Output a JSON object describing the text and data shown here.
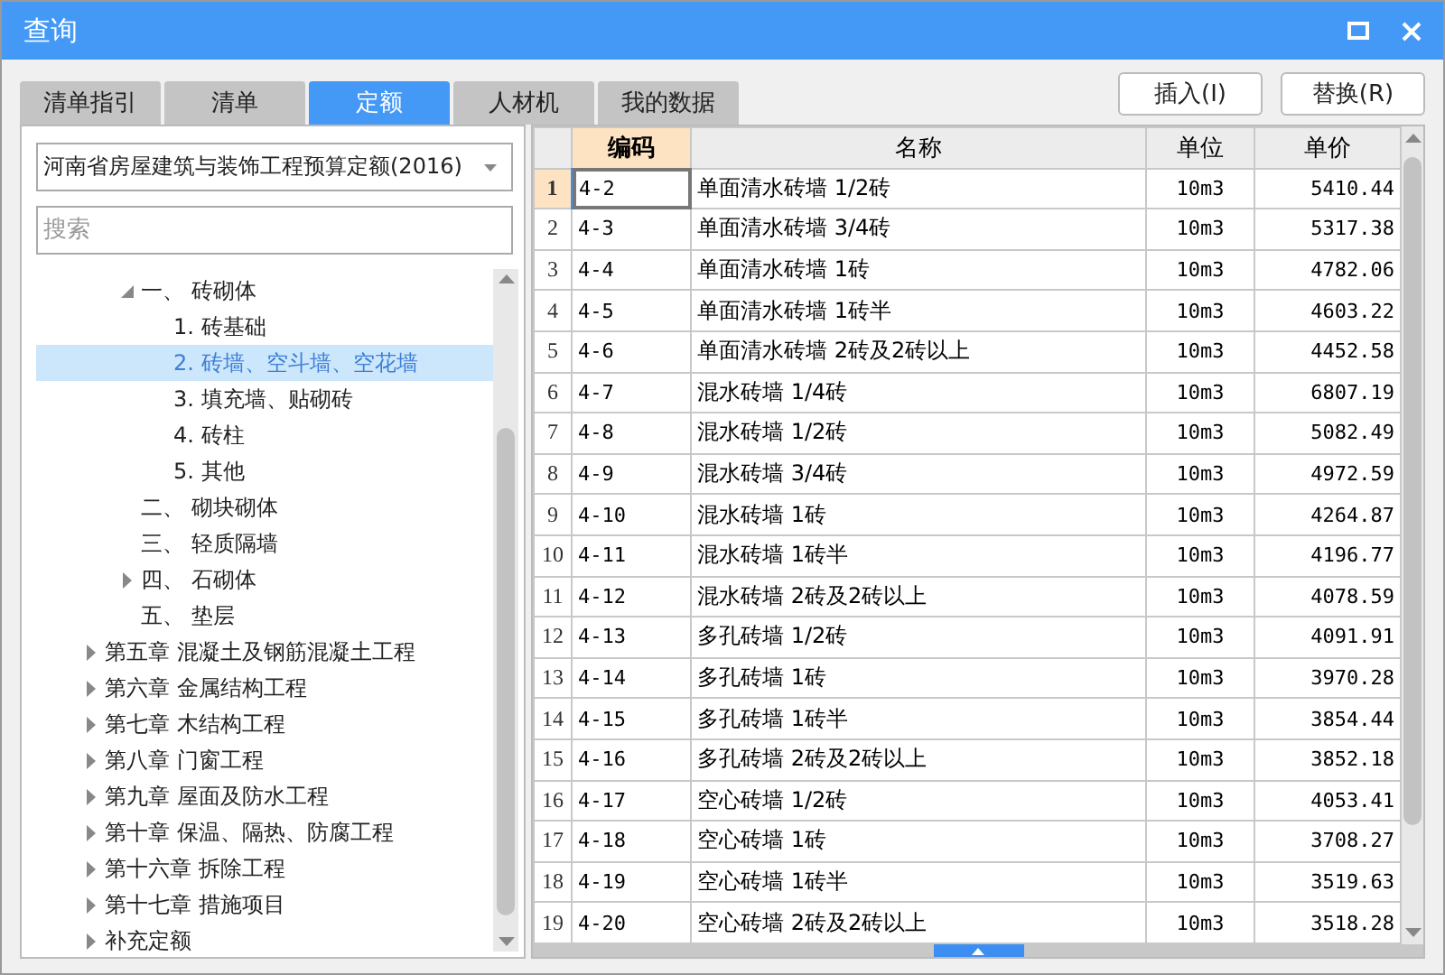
{
  "window": {
    "title": "查询"
  },
  "tabs": [
    {
      "label": "清单指引",
      "selected": false
    },
    {
      "label": "清单",
      "selected": false
    },
    {
      "label": "定额",
      "selected": true
    },
    {
      "label": "人材机",
      "selected": false
    },
    {
      "label": "我的数据",
      "selected": false
    }
  ],
  "buttons": [
    {
      "label": "插入(I)"
    },
    {
      "label": "替换(R)"
    }
  ],
  "library_select": {
    "value": "河南省房屋建筑与装饰工程预算定额(2016)"
  },
  "search": {
    "placeholder": "搜索"
  },
  "tree": {
    "sections": [
      {
        "label": "一、 砖砌体",
        "expanded": true,
        "selected": false,
        "children": [
          {
            "label": "1. 砖基础",
            "selected": false
          },
          {
            "label": "2. 砖墙、空斗墙、空花墙",
            "selected": true
          },
          {
            "label": "3. 填充墙、贴砌砖",
            "selected": false
          },
          {
            "label": "4. 砖柱",
            "selected": false
          },
          {
            "label": "5. 其他",
            "selected": false
          }
        ]
      },
      {
        "label": "二、 砌块砌体",
        "selected": false
      },
      {
        "label": "三、 轻质隔墙",
        "selected": false
      },
      {
        "label": "四、 石砌体",
        "expanded": false,
        "selected": false
      },
      {
        "label": "五、 垫层",
        "selected": false
      }
    ],
    "chapters": [
      {
        "label": "第五章 混凝土及钢筋混凝土工程",
        "expanded": false,
        "selected": false
      },
      {
        "label": "第六章 金属结构工程",
        "expanded": false,
        "selected": false
      },
      {
        "label": "第七章 木结构工程",
        "expanded": false,
        "selected": false
      },
      {
        "label": "第八章 门窗工程",
        "expanded": false,
        "selected": false
      },
      {
        "label": "第九章 屋面及防水工程",
        "expanded": false,
        "selected": false
      },
      {
        "label": "第十章 保温、隔热、防腐工程",
        "expanded": false,
        "selected": false
      },
      {
        "label": "第十六章 拆除工程",
        "expanded": false,
        "selected": false
      },
      {
        "label": "第十七章 措施项目",
        "expanded": false,
        "selected": false
      },
      {
        "label": "补充定额",
        "expanded": false,
        "selected": false
      }
    ]
  },
  "table": {
    "columns": [
      {
        "label": "编码",
        "selected": true
      },
      {
        "label": "名称",
        "selected": false
      },
      {
        "label": "单位",
        "selected": false
      },
      {
        "label": "单价",
        "selected": false
      }
    ],
    "rows": [
      {
        "num": "1",
        "code": "4-2",
        "name": "单面清水砖墙 1/2砖",
        "unit": "10m3",
        "price": "5410.44",
        "selected": true
      },
      {
        "num": "2",
        "code": "4-3",
        "name": "单面清水砖墙 3/4砖",
        "unit": "10m3",
        "price": "5317.38",
        "selected": false
      },
      {
        "num": "3",
        "code": "4-4",
        "name": "单面清水砖墙 1砖",
        "unit": "10m3",
        "price": "4782.06",
        "selected": false
      },
      {
        "num": "4",
        "code": "4-5",
        "name": "单面清水砖墙 1砖半",
        "unit": "10m3",
        "price": "4603.22",
        "selected": false
      },
      {
        "num": "5",
        "code": "4-6",
        "name": "单面清水砖墙 2砖及2砖以上",
        "unit": "10m3",
        "price": "4452.58",
        "selected": false
      },
      {
        "num": "6",
        "code": "4-7",
        "name": "混水砖墙 1/4砖",
        "unit": "10m3",
        "price": "6807.19",
        "selected": false
      },
      {
        "num": "7",
        "code": "4-8",
        "name": "混水砖墙 1/2砖",
        "unit": "10m3",
        "price": "5082.49",
        "selected": false
      },
      {
        "num": "8",
        "code": "4-9",
        "name": "混水砖墙 3/4砖",
        "unit": "10m3",
        "price": "4972.59",
        "selected": false
      },
      {
        "num": "9",
        "code": "4-10",
        "name": "混水砖墙 1砖",
        "unit": "10m3",
        "price": "4264.87",
        "selected": false
      },
      {
        "num": "10",
        "code": "4-11",
        "name": "混水砖墙 1砖半",
        "unit": "10m3",
        "price": "4196.77",
        "selected": false
      },
      {
        "num": "11",
        "code": "4-12",
        "name": "混水砖墙 2砖及2砖以上",
        "unit": "10m3",
        "price": "4078.59",
        "selected": false
      },
      {
        "num": "12",
        "code": "4-13",
        "name": "多孔砖墙 1/2砖",
        "unit": "10m3",
        "price": "4091.91",
        "selected": false
      },
      {
        "num": "13",
        "code": "4-14",
        "name": "多孔砖墙 1砖",
        "unit": "10m3",
        "price": "3970.28",
        "selected": false
      },
      {
        "num": "14",
        "code": "4-15",
        "name": "多孔砖墙 1砖半",
        "unit": "10m3",
        "price": "3854.44",
        "selected": false
      },
      {
        "num": "15",
        "code": "4-16",
        "name": "多孔砖墙 2砖及2砖以上",
        "unit": "10m3",
        "price": "3852.18",
        "selected": false
      },
      {
        "num": "16",
        "code": "4-17",
        "name": "空心砖墙 1/2砖",
        "unit": "10m3",
        "price": "4053.41",
        "selected": false
      },
      {
        "num": "17",
        "code": "4-18",
        "name": "空心砖墙 1砖",
        "unit": "10m3",
        "price": "3708.27",
        "selected": false
      },
      {
        "num": "18",
        "code": "4-19",
        "name": "空心砖墙 1砖半",
        "unit": "10m3",
        "price": "3519.63",
        "selected": false
      },
      {
        "num": "19",
        "code": "4-20",
        "name": "空心砖墙 2砖及2砖以上",
        "unit": "10m3",
        "price": "3518.28",
        "selected": false
      }
    ]
  }
}
